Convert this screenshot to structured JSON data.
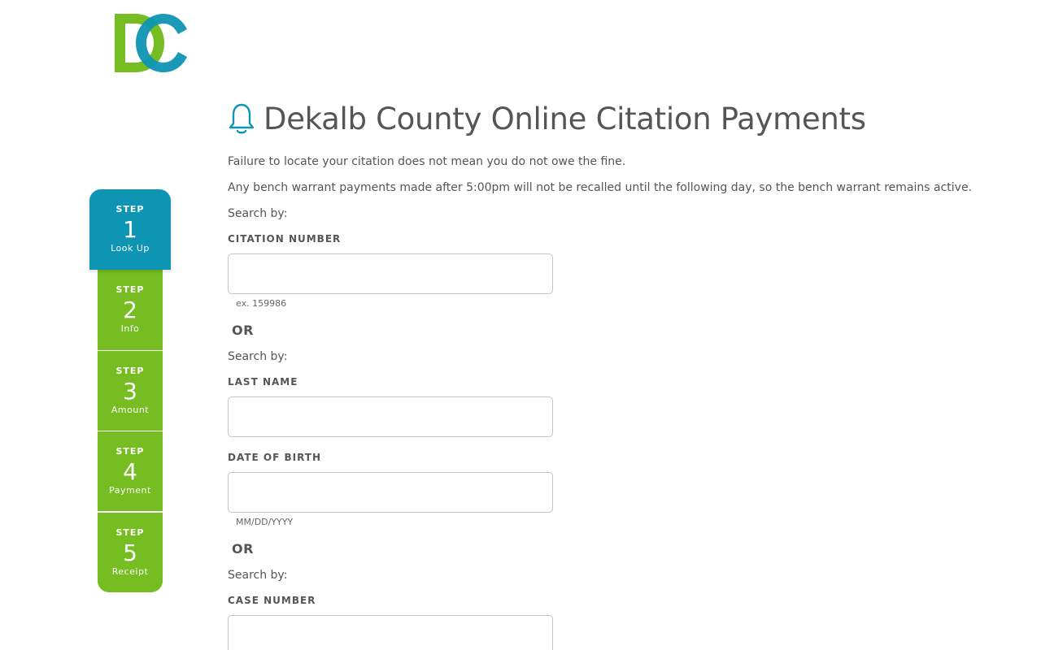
{
  "brand": {
    "logo_text": "DC",
    "green": "#76bd22",
    "blue": "#0e95b3"
  },
  "header": {
    "title": "Dekalb County Online Citation Payments",
    "icon": "bell-icon"
  },
  "notices": {
    "line1": "Failure to locate your citation does not mean you do not owe the fine.",
    "line2": "Any bench warrant payments made after 5:00pm will not be recalled until the following day, so the bench warrant remains active."
  },
  "steps": [
    {
      "label": "STEP",
      "number": "1",
      "name": "Look Up",
      "active": true
    },
    {
      "label": "STEP",
      "number": "2",
      "name": "Info",
      "active": false
    },
    {
      "label": "STEP",
      "number": "3",
      "name": "Amount",
      "active": false
    },
    {
      "label": "STEP",
      "number": "4",
      "name": "Payment",
      "active": false
    },
    {
      "label": "STEP",
      "number": "5",
      "name": "Receipt",
      "active": false
    }
  ],
  "search": {
    "search_by": "Search by:",
    "or": "OR",
    "citation": {
      "label": "CITATION NUMBER",
      "value": "",
      "hint": "ex. 159986"
    },
    "last_name": {
      "label": "LAST NAME",
      "value": ""
    },
    "dob": {
      "label": "DATE OF BIRTH",
      "value": "",
      "hint": "MM/DD/YYYY"
    },
    "case_number": {
      "label": "CASE NUMBER",
      "value": ""
    }
  }
}
